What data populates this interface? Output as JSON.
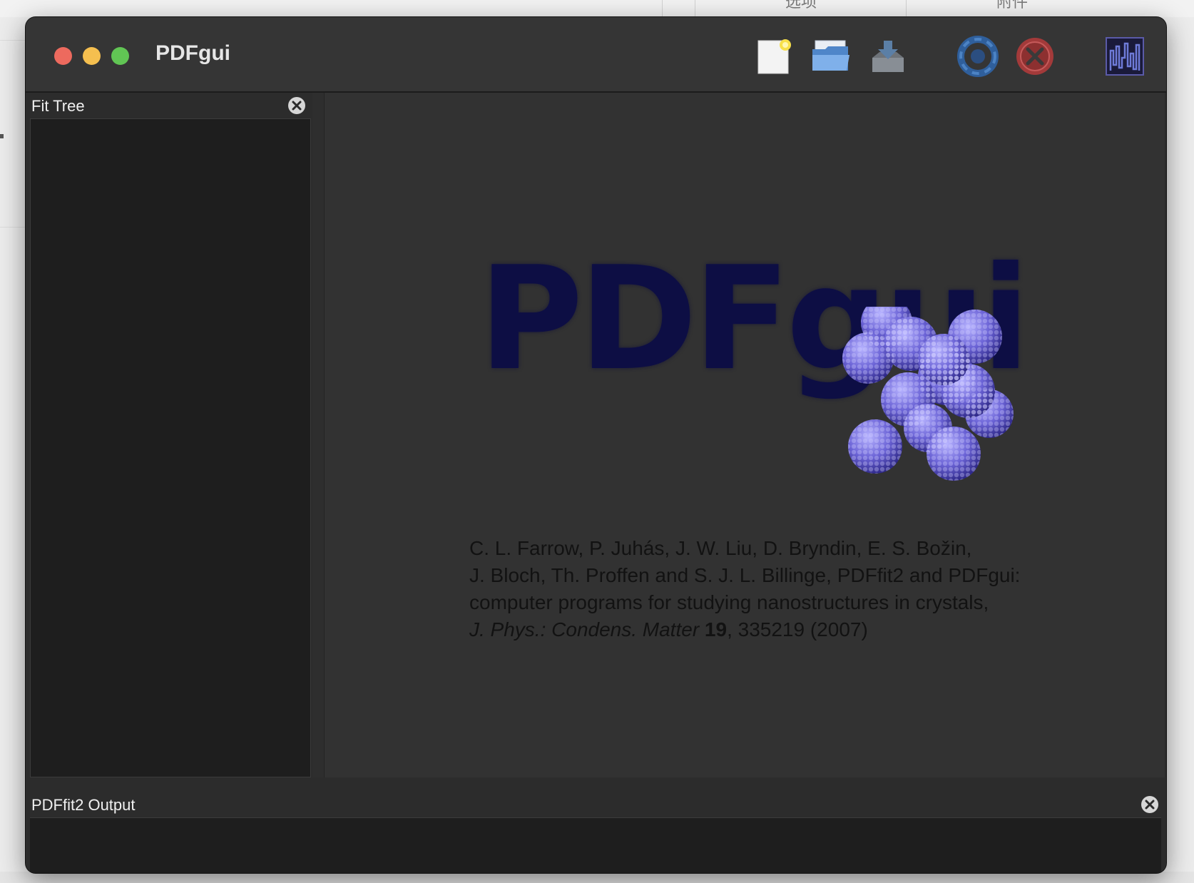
{
  "background_app": {
    "tabs": [
      "选项",
      "附件"
    ]
  },
  "window": {
    "title": "PDFgui"
  },
  "toolbar": {
    "icons": [
      "new-document-icon",
      "open-folder-icon",
      "save-icon",
      "run-fit-icon",
      "stop-fit-icon",
      "plot-icon"
    ]
  },
  "fit_tree": {
    "title": "Fit Tree"
  },
  "main": {
    "logo_text": "PDFgui",
    "citation": {
      "line1": "C. L. Farrow, P. Juhás, J. W. Liu, D. Bryndin, E. S. Božin,",
      "line2": "J. Bloch, Th. Proffen and S. J. L. Billinge, PDFfit2 and PDFgui:",
      "line3": "computer programs for studying nanostructures in crystals,",
      "journal": "J. Phys.: Condens. Matter",
      "volume": "19",
      "rest": ", 335219 (2007)"
    }
  },
  "output": {
    "title": "PDFfit2 Output"
  },
  "colors": {
    "close": "#ed6a5e",
    "minimize": "#f5bf4f",
    "maximize": "#61c554",
    "logo": "#0d0e44",
    "molecule": "#6b63d6"
  }
}
